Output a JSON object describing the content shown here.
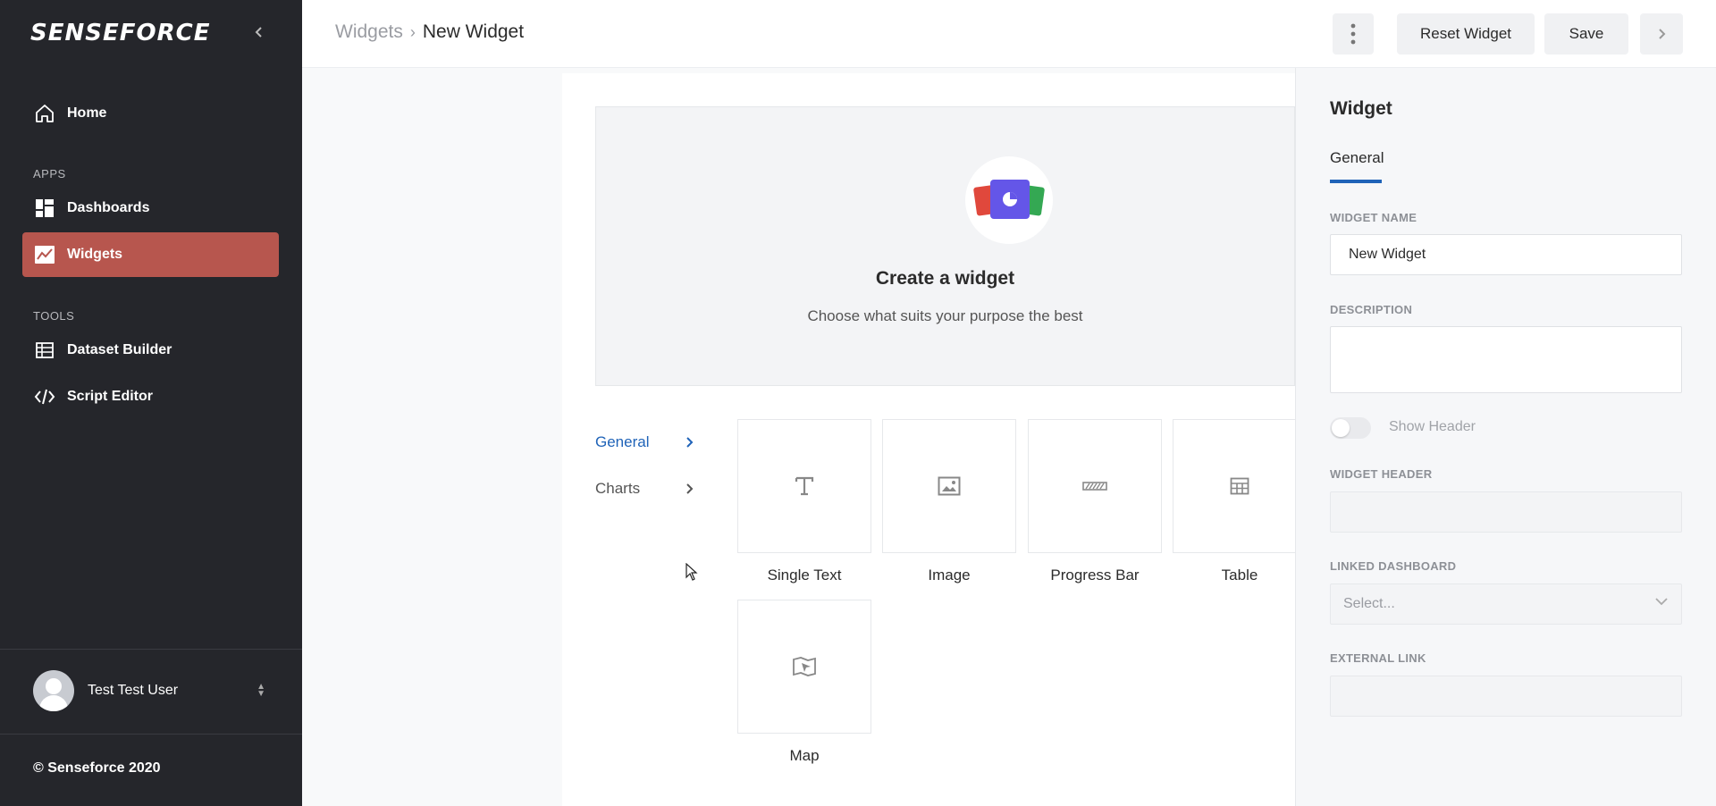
{
  "sidebar": {
    "logo": "SENSEFORCE",
    "home_label": "Home",
    "apps_label": "APPS",
    "dashboards_label": "Dashboards",
    "widgets_label": "Widgets",
    "tools_label": "TOOLS",
    "dataset_builder_label": "Dataset Builder",
    "script_editor_label": "Script Editor",
    "user_name": "Test Test User",
    "copyright": "© Senseforce 2020",
    "active_color": "#b7564e",
    "background": "#25262b"
  },
  "header": {
    "breadcrumb_parent": "Widgets",
    "breadcrumb_current": "New Widget",
    "reset_label": "Reset Widget",
    "save_label": "Save"
  },
  "main": {
    "hero_title": "Create a widget",
    "hero_subtitle": "Choose what suits your purpose the best",
    "categories": [
      {
        "label": "General",
        "active": true
      },
      {
        "label": "Charts",
        "active": false
      }
    ],
    "tiles": [
      {
        "label": "Single Text",
        "icon": "text-icon"
      },
      {
        "label": "Image",
        "icon": "image-icon"
      },
      {
        "label": "Progress Bar",
        "icon": "progress-bar-icon"
      },
      {
        "label": "Table",
        "icon": "table-icon"
      },
      {
        "label": "Map",
        "icon": "map-icon"
      }
    ]
  },
  "panel": {
    "title": "Widget",
    "tab": "General",
    "widget_name_label": "WIDGET NAME",
    "widget_name_value": "New Widget",
    "description_label": "DESCRIPTION",
    "description_value": "",
    "show_header_label": "Show Header",
    "show_header_on": false,
    "widget_header_label": "WIDGET HEADER",
    "linked_dashboard_label": "LINKED DASHBOARD",
    "linked_dashboard_placeholder": "Select...",
    "external_link_label": "EXTERNAL LINK",
    "accent_color": "#1f63b8"
  }
}
